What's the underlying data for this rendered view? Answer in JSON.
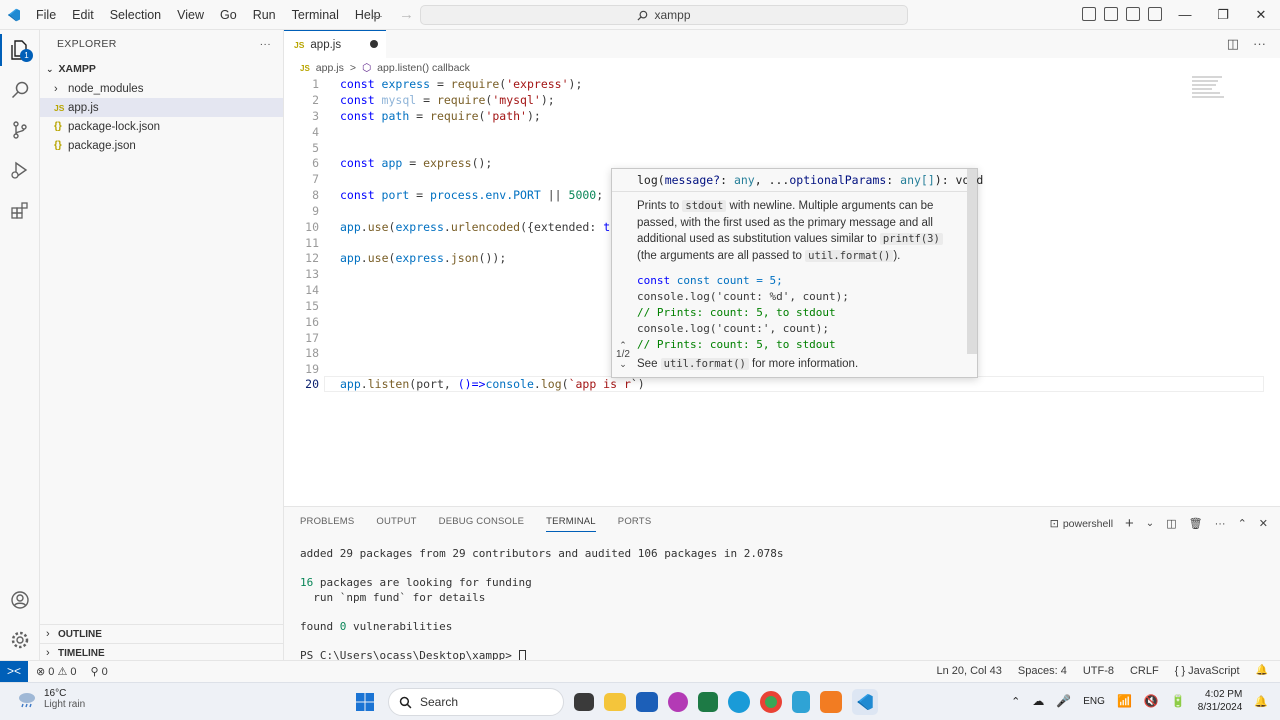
{
  "titlebar": {
    "menu": [
      "File",
      "Edit",
      "Selection",
      "View",
      "Go",
      "Run",
      "Terminal",
      "Help"
    ],
    "search": "xampp",
    "window_controls": [
      "—",
      "❐",
      "✕"
    ]
  },
  "sidebar": {
    "header": "EXPLORER",
    "more": "···",
    "folder": "XAMPP",
    "items": [
      {
        "label": "node_modules",
        "type": "folder"
      },
      {
        "label": "app.js",
        "type": "js",
        "icon_text": "JS"
      },
      {
        "label": "package-lock.json",
        "type": "json",
        "icon_text": "{}"
      },
      {
        "label": "package.json",
        "type": "json",
        "icon_text": "{}"
      }
    ],
    "outline": "OUTLINE",
    "timeline": "TIMELINE",
    "badge": "1"
  },
  "tab": {
    "icon_text": "JS",
    "label": "app.js"
  },
  "breadcrumb": {
    "file_icon": "JS",
    "file": "app.js",
    "sep": ">",
    "symbol": "app.listen() callback"
  },
  "editor": {
    "line_numbers": [
      "1",
      "2",
      "3",
      "4",
      "5",
      "6",
      "7",
      "8",
      "9",
      "10",
      "11",
      "12",
      "13",
      "14",
      "15",
      "16",
      "17",
      "18",
      "19",
      "20"
    ],
    "lines": {
      "l1": {
        "kw": "const ",
        "var": "express",
        "rest": " = ",
        "fn": "require",
        "open": "(",
        "str": "'express'",
        "close": ");"
      },
      "l2": {
        "kw": "const ",
        "var": "mysql",
        "rest": " = ",
        "fn": "require",
        "open": "(",
        "str": "'mysql'",
        "close": ");"
      },
      "l3": {
        "kw": "const ",
        "var": "path",
        "rest": " = ",
        "fn": "require",
        "open": "(",
        "str": "'path'",
        "close": ");"
      },
      "l6": {
        "kw": "const ",
        "var": "app",
        "rest": " = ",
        "fn": "express",
        "close": "();"
      },
      "l8": {
        "kw": "const ",
        "var": "port",
        "rest": " = ",
        "obj": "process.env.PORT",
        "op": " || ",
        "num": "5000",
        "close": ";"
      },
      "l10": {
        "obj": "app",
        "dot": ".",
        "fn": "use",
        "open": "(",
        "obj2": "express",
        "dot2": ".",
        "fn2": "urlencoded",
        "rest": "({extended: ",
        "kw": "true"
      },
      "l12": {
        "obj": "app",
        "dot": ".",
        "fn": "use",
        "open": "(",
        "obj2": "express",
        "dot2": ".",
        "fn2": "json",
        "close": "());"
      },
      "l20": {
        "obj": "app",
        "dot": ".",
        "fn": "listen",
        "rest": "(port, ",
        "arrow": "()=>",
        "obj2": "console",
        "dot2": ".",
        "fn2": "log",
        "open": "(",
        "str": "`app is r",
        "close": "`)"
      }
    }
  },
  "hover": {
    "sig_fn": "log(",
    "sig_p1": "message?",
    "sig_c1": ": ",
    "sig_t1": "any",
    "sig_c2": ", ...",
    "sig_p2": "optionalParams",
    "sig_c3": ": ",
    "sig_t2": "any[]",
    "sig_end": "): void",
    "desc_a": "Prints to ",
    "desc_code1": "stdout",
    "desc_b": " with newline. Multiple arguments can be passed, with the first used as the primary message and all additional used as substitution values similar to ",
    "desc_code2": "printf(3)",
    "desc_c": " (the arguments are all passed to ",
    "desc_code3": "util.format()",
    "desc_d": ").",
    "ex1": "const count = 5;",
    "ex2": "console.log('count: %d', count);",
    "ex3": "// Prints: count: 5, to stdout",
    "ex4": "console.log('count:', count);",
    "ex5": "// Prints: count: 5, to stdout",
    "see_a": "See ",
    "see_code": "util.format()",
    "see_b": " for more information.",
    "pager": "1/2"
  },
  "panel": {
    "tabs": [
      "PROBLEMS",
      "OUTPUT",
      "DEBUG CONSOLE",
      "TERMINAL",
      "PORTS"
    ],
    "active_tab": "TERMINAL",
    "shell": "powershell",
    "terminal": {
      "t1": "added 29 packages from 29 contributors and audited 106 packages in 2.078s",
      "t2a": "16",
      "t2b": " packages are looking for funding",
      "t3": "  run `npm fund` for details",
      "t4a": "found ",
      "t4b": "0",
      "t4c": " vulnerabilities",
      "prompt": "PS C:\\Users\\ocass\\Desktop\\xampp> "
    }
  },
  "statusbar": {
    "remote": "><",
    "errors": "⊗ 0 ⚠ 0",
    "ports": "⚲ 0",
    "position": "Ln 20, Col 43",
    "spaces": "Spaces: 4",
    "encoding": "UTF-8",
    "eol": "CRLF",
    "language": "{ } JavaScript",
    "notifications": "🔔"
  },
  "taskbar": {
    "temp": "16°C",
    "weather": "Light rain",
    "search": "Search",
    "lang": "ENG",
    "time": "4:02 PM",
    "date": "8/31/2024"
  },
  "colors": {
    "accent": "#005fb8",
    "keyword": "#0000ff",
    "string": "#a31515",
    "number": "#098658",
    "function": "#795e26"
  }
}
